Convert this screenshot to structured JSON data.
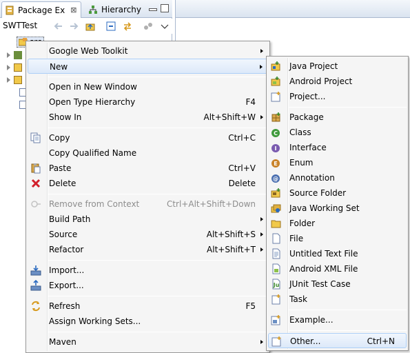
{
  "package_explorer": {
    "tabs": [
      {
        "label": "Package Ex",
        "close": "⊠"
      },
      {
        "label": "Hierarchy"
      }
    ],
    "project_label": "SWTTest",
    "src_item": "src"
  },
  "context_menu": {
    "items": [
      {
        "label": "Google Web Toolkit",
        "shortcut": "",
        "submenu": true,
        "icon": "none"
      },
      {
        "label": "New",
        "shortcut": "",
        "submenu": true,
        "icon": "none",
        "highlighted": true
      },
      {
        "label": "Open in New Window",
        "shortcut": "",
        "icon": "none"
      },
      {
        "label": "Open Type Hierarchy",
        "shortcut": "F4",
        "icon": "none"
      },
      {
        "label": "Show In",
        "shortcut": "Alt+Shift+W",
        "submenu": true,
        "icon": "none"
      },
      {
        "label": "Copy",
        "shortcut": "Ctrl+C",
        "icon": "copy-icon"
      },
      {
        "label": "Copy Qualified Name",
        "shortcut": "",
        "icon": "copy-qualified-icon"
      },
      {
        "label": "Paste",
        "shortcut": "Ctrl+V",
        "icon": "paste-icon"
      },
      {
        "label": "Delete",
        "shortcut": "Delete",
        "icon": "delete-icon"
      },
      {
        "label": "Remove from Context",
        "shortcut": "Ctrl+Alt+Shift+Down",
        "icon": "remove-context-icon",
        "disabled": true
      },
      {
        "label": "Build Path",
        "shortcut": "",
        "submenu": true,
        "icon": "none"
      },
      {
        "label": "Source",
        "shortcut": "Alt+Shift+S",
        "submenu": true,
        "icon": "none"
      },
      {
        "label": "Refactor",
        "shortcut": "Alt+Shift+T",
        "submenu": true,
        "icon": "none"
      },
      {
        "label": "Import...",
        "shortcut": "",
        "icon": "import-icon"
      },
      {
        "label": "Export...",
        "shortcut": "",
        "icon": "export-icon"
      },
      {
        "label": "Refresh",
        "shortcut": "F5",
        "icon": "refresh-icon"
      },
      {
        "label": "Assign Working Sets...",
        "shortcut": "",
        "icon": "none"
      },
      {
        "label": "Maven",
        "shortcut": "",
        "submenu": true,
        "icon": "none"
      }
    ]
  },
  "new_submenu": {
    "items": [
      {
        "label": "Java Project",
        "shortcut": "",
        "icon": "java-project-icon"
      },
      {
        "label": "Android Project",
        "shortcut": "",
        "icon": "android-project-icon"
      },
      {
        "label": "Project...",
        "shortcut": "",
        "icon": "project-icon"
      },
      {
        "label": "Package",
        "shortcut": "",
        "icon": "package-icon"
      },
      {
        "label": "Class",
        "shortcut": "",
        "icon": "class-icon"
      },
      {
        "label": "Interface",
        "shortcut": "",
        "icon": "interface-icon"
      },
      {
        "label": "Enum",
        "shortcut": "",
        "icon": "enum-icon"
      },
      {
        "label": "Annotation",
        "shortcut": "",
        "icon": "annotation-icon"
      },
      {
        "label": "Source Folder",
        "shortcut": "",
        "icon": "source-folder-icon"
      },
      {
        "label": "Java Working Set",
        "shortcut": "",
        "icon": "working-set-icon"
      },
      {
        "label": "Folder",
        "shortcut": "",
        "icon": "folder-icon"
      },
      {
        "label": "File",
        "shortcut": "",
        "icon": "file-icon"
      },
      {
        "label": "Untitled Text File",
        "shortcut": "",
        "icon": "text-file-icon"
      },
      {
        "label": "Android XML File",
        "shortcut": "",
        "icon": "android-xml-icon"
      },
      {
        "label": "JUnit Test Case",
        "shortcut": "",
        "icon": "junit-icon"
      },
      {
        "label": "Task",
        "shortcut": "",
        "icon": "task-icon"
      },
      {
        "label": "Example...",
        "shortcut": "",
        "icon": "example-icon"
      },
      {
        "label": "Other...",
        "shortcut": "Ctrl+N",
        "icon": "other-icon",
        "highlighted": true
      }
    ]
  },
  "colors": {
    "highlight_border": "#aecff7",
    "menu_bg": "#f5f5f5",
    "disabled_text": "#8d8d8d"
  }
}
